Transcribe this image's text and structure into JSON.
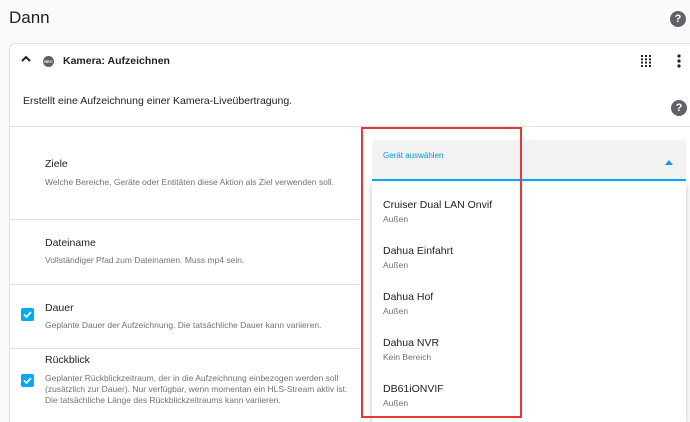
{
  "page": {
    "title": "Dann",
    "help_icon": "help-icon"
  },
  "card": {
    "title": "Kamera: Aufzeichnen",
    "badge": "REC",
    "description": "Erstellt eine Aufzeichnung einer Kamera-Liveübertragung.",
    "icons": [
      "chevron-up-icon",
      "rec-icon",
      "grid-dots-icon",
      "more-vert-icon",
      "help-icon"
    ],
    "fields": [
      {
        "name": "Ziele",
        "description": "Welche Bereiche, Geräte oder Entitäten diese Aktion als Ziel verwenden soll.",
        "checked": null
      },
      {
        "name": "Dateiname",
        "description": "Vollständiger Pfad zum Dateinamen. Muss mp4 sein.",
        "checked": null
      },
      {
        "name": "Dauer",
        "description": "Geplante Dauer der Aufzeichnung. Die tatsächliche Dauer kann variieren.",
        "checked": true
      },
      {
        "name": "Rückblick",
        "description_lines": [
          "Geplanter Rückblickzeitraum, der in die Aufzeichnung einbezogen werden soll",
          "(zusätzlich zur Dauer). Nur verfügbar, wenn momentan ein HLS-Stream aktiv ist.",
          "Die tatsächliche Länge des Rückblickzeitraums kann variieren."
        ],
        "checked": true
      }
    ]
  },
  "device_picker": {
    "label": "Gerät auswählen",
    "accent_color": "#03a9f4",
    "options": [
      {
        "name": "Cruiser Dual LAN Onvif",
        "area": "Außen"
      },
      {
        "name": "Dahua Einfahrt",
        "area": "Außen"
      },
      {
        "name": "Dahua Hof",
        "area": "Außen"
      },
      {
        "name": "Dahua NVR",
        "area": "Kein Bereich"
      },
      {
        "name": "DB61iONVIF",
        "area": "Außen"
      }
    ]
  },
  "annotation": {
    "highlight_color": "#e53935"
  }
}
